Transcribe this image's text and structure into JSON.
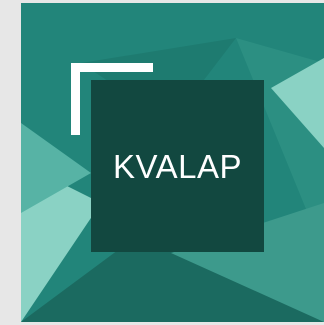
{
  "logo": {
    "text": "KVALAP"
  },
  "colors": {
    "background": "#e7e7e7",
    "tile_base": "#22857a",
    "tile_light": "#8ad2c4",
    "tile_mid": "#3d9a8c",
    "tile_dark": "#1b6a60",
    "logo_box": "#124840",
    "bracket": "#ffffff"
  }
}
